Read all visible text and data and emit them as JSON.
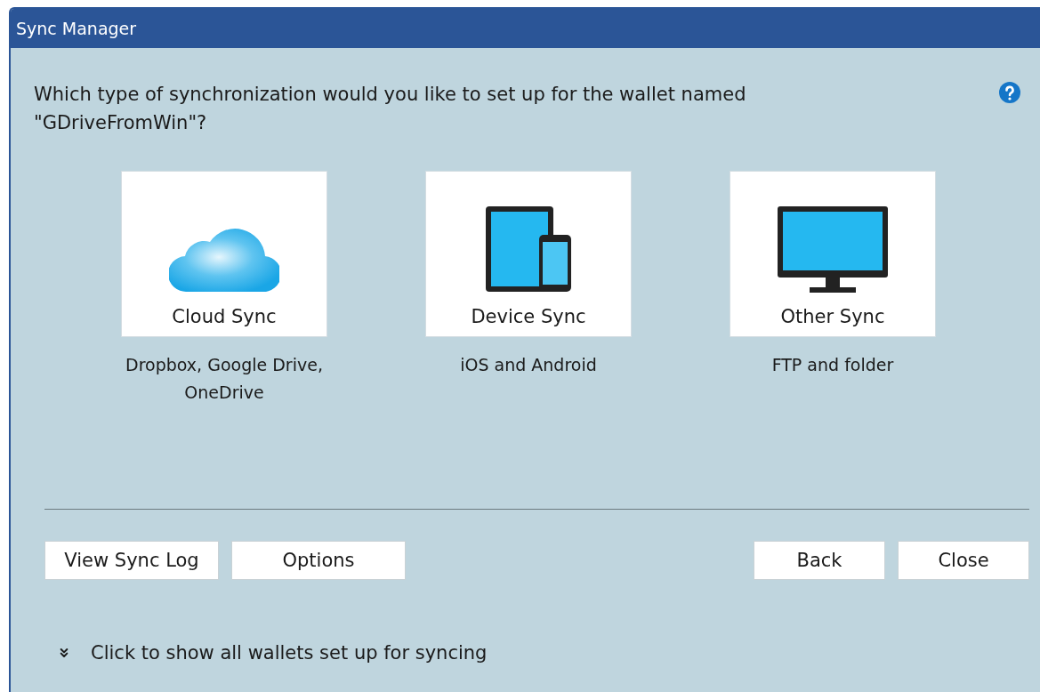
{
  "window": {
    "title": "Sync Manager"
  },
  "question": "Which type of synchronization would you like to set up for the wallet named \"GDriveFromWin\"?",
  "options": [
    {
      "kind": "cloud",
      "label": "Cloud Sync",
      "description": "Dropbox, Google Drive, OneDrive"
    },
    {
      "kind": "device",
      "label": "Device Sync",
      "description": "iOS and Android"
    },
    {
      "kind": "monitor",
      "label": "Other Sync",
      "description": "FTP and folder"
    }
  ],
  "left_buttons": [
    "View Sync Log",
    "Options"
  ],
  "right_buttons": [
    "Back",
    "Close"
  ],
  "expander": {
    "label": "Click to show all wallets set up for syncing",
    "expanded": false
  }
}
